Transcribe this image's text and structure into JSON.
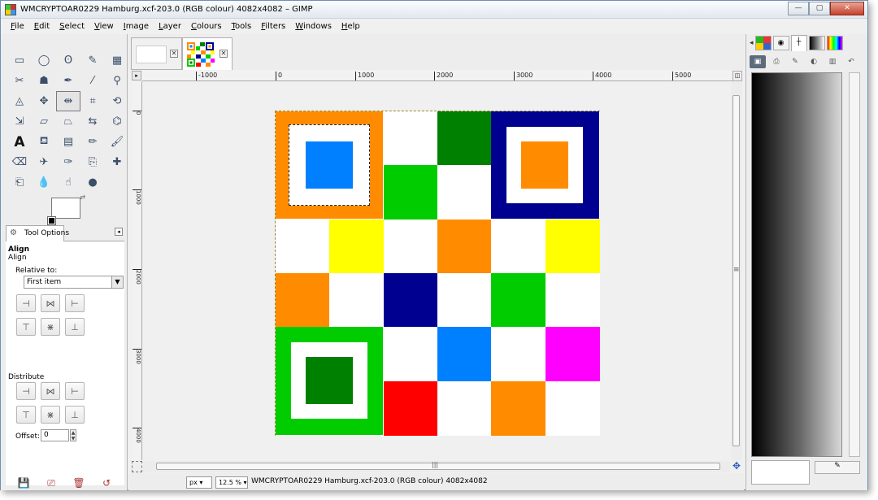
{
  "window": {
    "title": "WMCRYPTOAR0229 Hamburg.xcf-203.0 (RGB colour) 4082x4082 – GIMP",
    "minimize_label": "—",
    "restore_label": "▢",
    "close_label": "✕"
  },
  "menubar": {
    "items": [
      "File",
      "Edit",
      "Select",
      "View",
      "Image",
      "Layer",
      "Colours",
      "Tools",
      "Filters",
      "Windows",
      "Help"
    ]
  },
  "toolbox": {
    "tools": [
      "rect-select",
      "ellipse-select",
      "free-select",
      "fuzzy-select",
      "by-colour-select",
      "scissors-select",
      "foreground-select",
      "paths",
      "colour-picker",
      "zoom",
      "measure",
      "move",
      "align",
      "crop",
      "rotate",
      "scale",
      "shear",
      "perspective",
      "flip",
      "cage-transform",
      "text",
      "bucket-fill",
      "blend",
      "pencil",
      "paintbrush",
      "eraser",
      "airbrush",
      "ink",
      "clone",
      "heal",
      "perspective-clone",
      "blur",
      "smudge",
      "dodge-burn"
    ],
    "options_tab_label": "Tool Options",
    "align_heading": "Align",
    "align_sub": "Align",
    "relative_to_label": "Relative to:",
    "relative_to_value": "First item",
    "distribute_label": "Distribute",
    "offset_label": "Offset:",
    "offset_value": "0"
  },
  "ruler": {
    "h_labels": [
      "-1000",
      "0",
      "1000",
      "2000",
      "3000",
      "4000",
      "5000"
    ],
    "v_labels": [
      "0",
      "1000",
      "2000",
      "3000",
      "4000"
    ]
  },
  "image": {
    "grid": [
      [
        "white",
        "white",
        "white",
        "green",
        "white",
        "white"
      ],
      [
        "white",
        "white",
        "green2",
        "white",
        "white",
        "white"
      ],
      [
        "white",
        "yellow",
        "white",
        "orange",
        "white",
        "yellow"
      ],
      [
        "orange",
        "white",
        "navy",
        "white",
        "green2",
        "white"
      ],
      [
        "white",
        "white",
        "white",
        "blue",
        "white",
        "magenta"
      ],
      [
        "white",
        "white",
        "red",
        "white",
        "orange",
        "white"
      ]
    ],
    "colors": {
      "white": "#ffffff",
      "green": "#008000",
      "green2": "#00cc00",
      "yellow": "#ffff00",
      "orange": "#ff8c00",
      "navy": "#000090",
      "blue": "#0080ff",
      "magenta": "#ff00ff",
      "red": "#ff0000"
    }
  },
  "statusbar": {
    "unit": "px",
    "zoom": "12.5 %",
    "text": "WMCRYPTOAR0229 Hamburg.xcf-203.0 (RGB colour) 4082x4082"
  }
}
